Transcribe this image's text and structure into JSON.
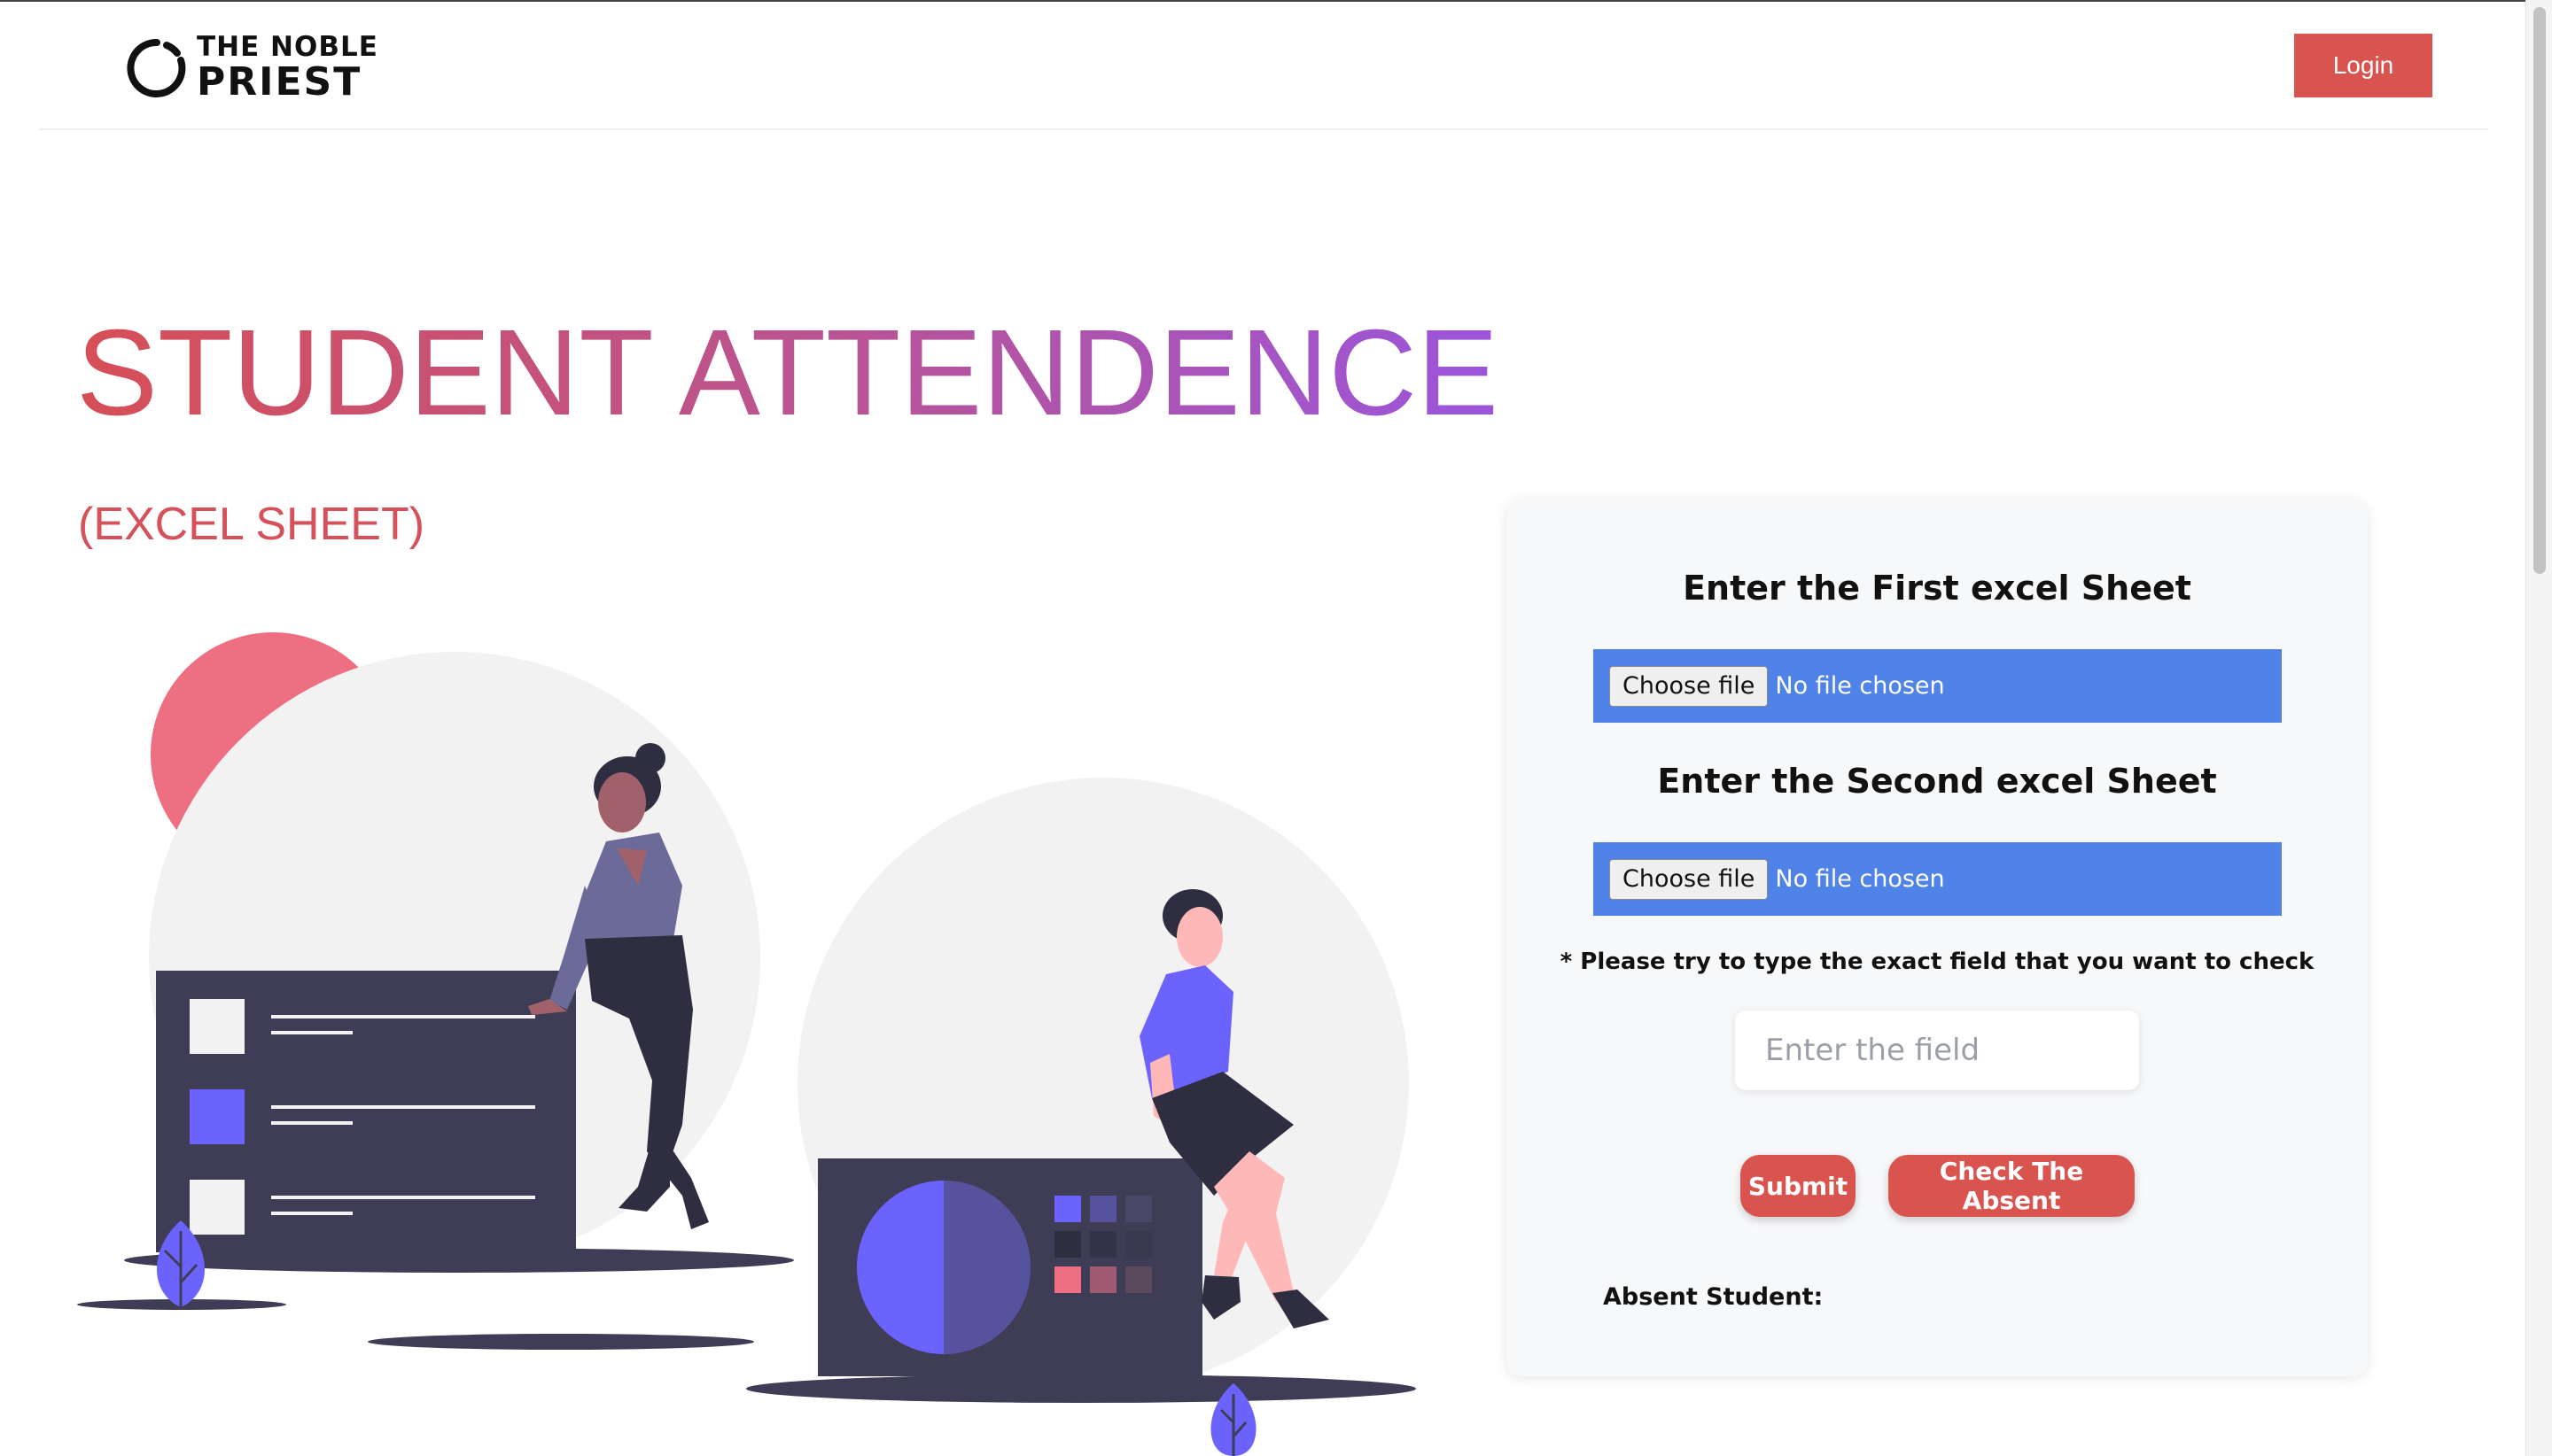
{
  "header": {
    "logo_line1": "THE NOBLE",
    "logo_line2": "PRIEST",
    "login_label": "Login"
  },
  "hero": {
    "title": "STUDENT ATTENDENCE",
    "subtitle": "(EXCEL SHEET)"
  },
  "form": {
    "first_heading": "Enter the First excel Sheet",
    "second_heading": "Enter the Second excel Sheet",
    "file_button_label": "Choose file",
    "file_status": "No file chosen",
    "note": "* Please try to type the exact field that you want to check",
    "field_placeholder": "Enter the field",
    "submit_label": "Submit",
    "check_label": "Check The Absent",
    "absent_label": "Absent Student:"
  },
  "colors": {
    "accent_red": "#d9534f",
    "file_input_blue": "#4f83e8",
    "illustration_purple": "#6c63ff",
    "illustration_dark": "#3f3d56",
    "illustration_pink": "#ee6e82"
  },
  "icons": {
    "logo": "noble-priest-ring-logo"
  }
}
